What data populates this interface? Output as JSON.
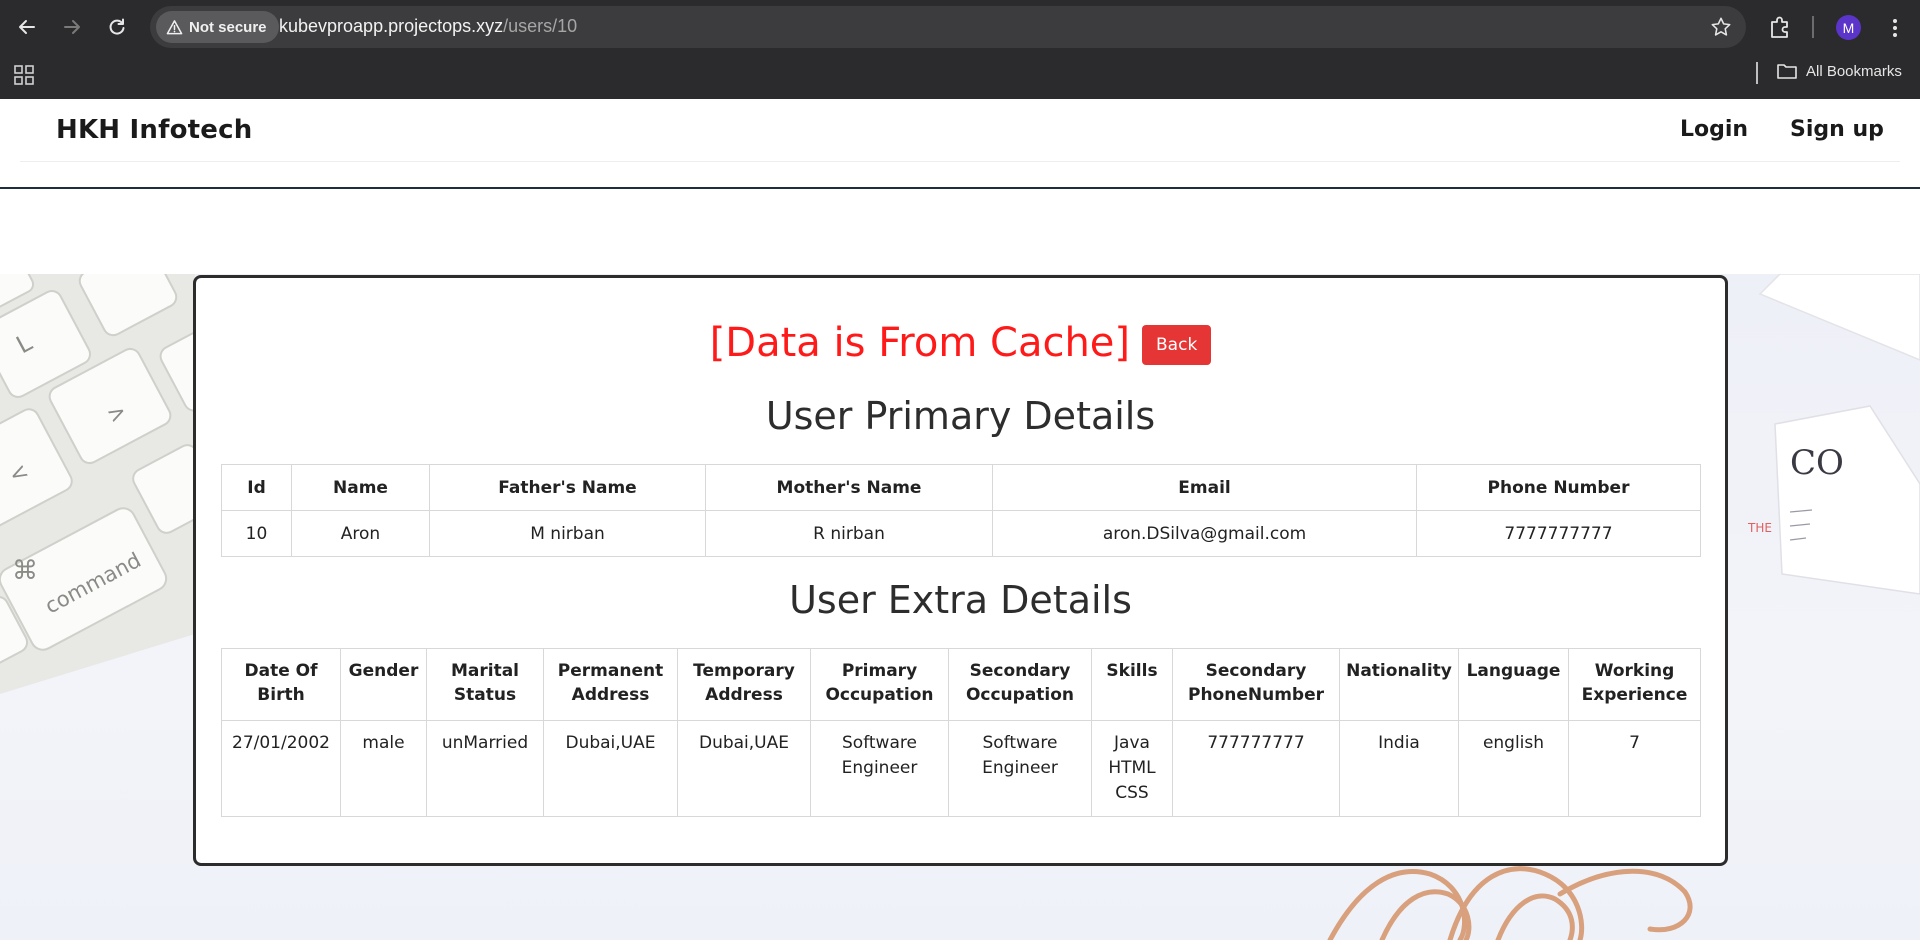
{
  "browser": {
    "security_label": "Not secure",
    "url_host": "kubevproapp.projectops.xyz",
    "url_path": "/users/10",
    "profile_initial": "M",
    "bookmarks_label": "All Bookmarks"
  },
  "site": {
    "brand": "HKH Infotech",
    "login_label": "Login",
    "signup_label": "Sign up"
  },
  "card": {
    "cache_note": "[Data is From Cache]",
    "back_label": "Back",
    "primary_title": "User Primary Details",
    "extra_title": "User Extra Details"
  },
  "primary_table": {
    "headers": [
      "Id",
      "Name",
      "Father's Name",
      "Mother's Name",
      "Email",
      "Phone Number"
    ],
    "row": [
      "10",
      "Aron",
      "M nirban",
      "R nirban",
      "aron.DSilva@gmail.com",
      "7777777777"
    ]
  },
  "extra_table": {
    "headers": [
      [
        "Date Of",
        "Birth"
      ],
      [
        "Gender"
      ],
      [
        "Marital",
        "Status"
      ],
      [
        "Permanent",
        "Address"
      ],
      [
        "Temporary",
        "Address"
      ],
      [
        "Primary",
        "Occupation"
      ],
      [
        "Secondary",
        "Occupation"
      ],
      [
        "Skills"
      ],
      [
        "Secondary",
        "PhoneNumber"
      ],
      [
        "Nationality"
      ],
      [
        "Language"
      ],
      [
        "Working",
        "Experience"
      ]
    ],
    "row": [
      [
        "27/01/2002"
      ],
      [
        "male"
      ],
      [
        "unMarried"
      ],
      [
        "Dubai,UAE"
      ],
      [
        "Dubai,UAE"
      ],
      [
        "Software",
        "Engineer"
      ],
      [
        "Software",
        "Engineer"
      ],
      [
        "Java",
        "HTML",
        "CSS"
      ],
      [
        "777777777"
      ],
      [
        "India"
      ],
      [
        "english"
      ],
      [
        "7"
      ]
    ]
  },
  "background": {
    "keyboard_label": "command",
    "card_text": "CO"
  },
  "colors": {
    "cache_red": "#ff1a1a",
    "back_button": "#e53535",
    "chrome_bg": "#2b2b2d",
    "profile_purple": "#5b35c9"
  },
  "icons": [
    "back-arrow-icon",
    "forward-arrow-icon",
    "reload-icon",
    "warning-icon",
    "star-icon",
    "extensions-icon",
    "kebab-menu-icon",
    "apps-grid-icon",
    "folder-icon"
  ]
}
